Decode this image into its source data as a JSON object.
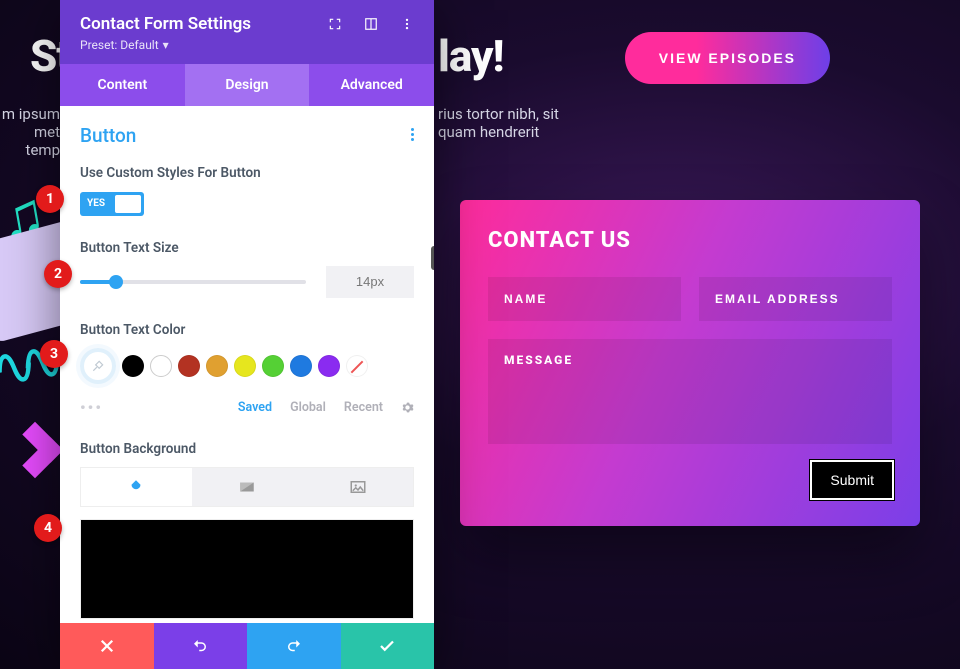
{
  "bg": {
    "headline_left": "St",
    "headline_right": "lay!",
    "para_left1": "m ipsum",
    "para_left2": "met temp",
    "para_right1": "rius tortor nibh, sit",
    "para_right2": "quam hendrerit",
    "view_episodes": "VIEW EPISODES"
  },
  "contact": {
    "title": "CONTACT US",
    "name_ph": "NAME",
    "email_ph": "EMAIL ADDRESS",
    "message_ph": "MESSAGE",
    "submit": "Submit"
  },
  "panel": {
    "title": "Contact Form Settings",
    "preset_label": "Preset: Default",
    "tabs": {
      "content": "Content",
      "design": "Design",
      "advanced": "Advanced"
    },
    "section": "Button",
    "opt_use_custom": "Use Custom Styles For Button",
    "toggle_yes": "YES",
    "opt_text_size": "Button Text Size",
    "text_size_val": "14px",
    "opt_text_color": "Button Text Color",
    "color_tabs": {
      "saved": "Saved",
      "global": "Global",
      "recent": "Recent"
    },
    "opt_background": "Button Background",
    "swatches": [
      "#000000",
      "#ffffff",
      "#b33222",
      "#e0a030",
      "#e6e61e",
      "#55d035",
      "#1f7ae0",
      "#8a2bf0"
    ]
  },
  "badges": {
    "b1": "1",
    "b2": "2",
    "b3": "3",
    "b4": "4"
  }
}
